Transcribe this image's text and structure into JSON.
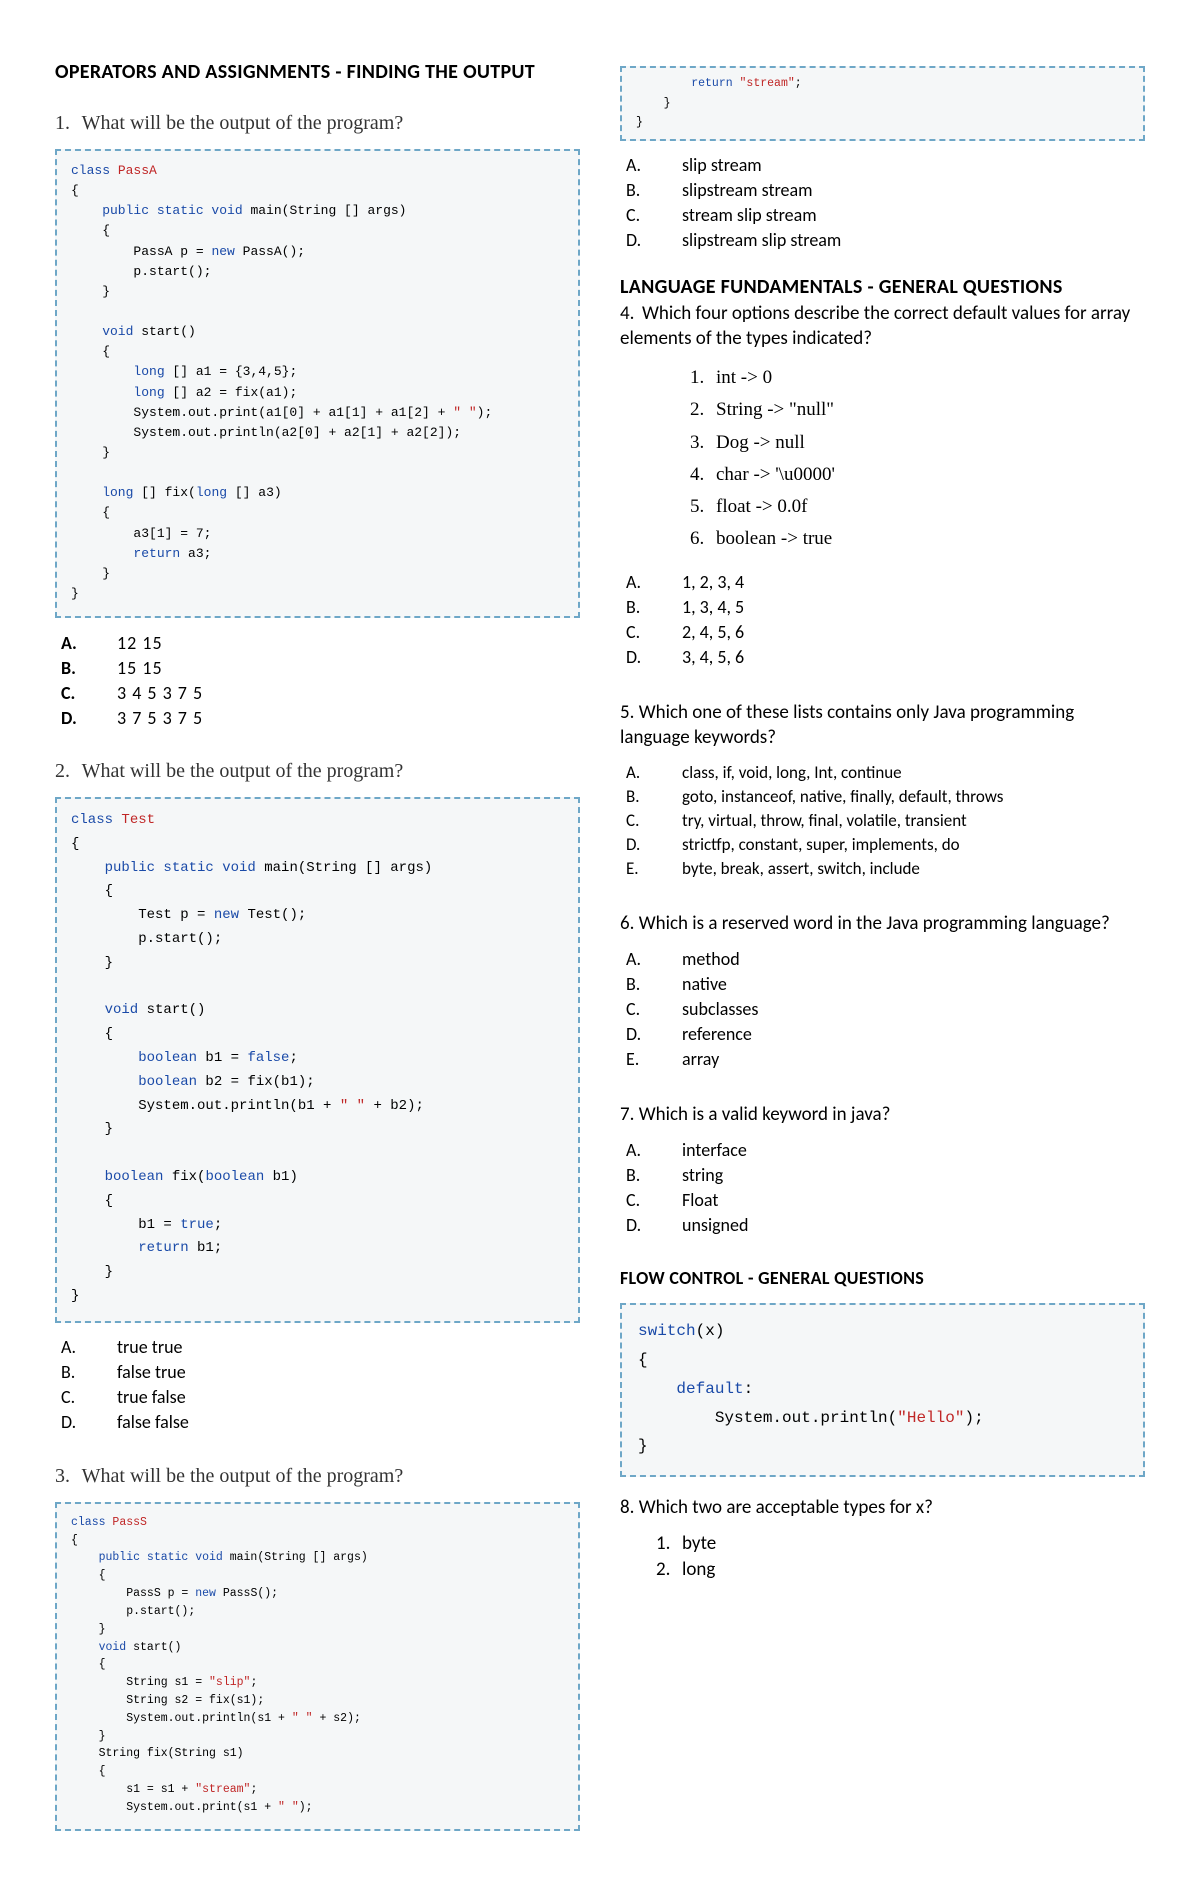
{
  "left": {
    "section1_title": "OPERATORS AND ASSIGNMENTS - FINDING THE OUTPUT",
    "q1": {
      "num": "1.",
      "text": "What will be the output of the program?",
      "code": {
        "l01a": "class ",
        "l01b": "PassA",
        "l02": "{",
        "l03a": "    public static void",
        "l03b": " main(String [] args)",
        "l04": "    {",
        "l05a": "        PassA p = ",
        "l05b": "new",
        "l05c": " PassA();",
        "l06": "        p.start();",
        "l07": "    }",
        "l08": "",
        "l09a": "    void",
        "l09b": " start()",
        "l10": "    {",
        "l11a": "        long",
        "l11b": " [] a1 = {3,4,5};",
        "l12a": "        long",
        "l12b": " [] a2 = fix(a1);",
        "l13a": "        System.out.print(a1[0] + a1[1] + a1[2] + ",
        "l13b": "\" \"",
        "l13c": ");",
        "l14": "        System.out.println(a2[0] + a2[1] + a2[2]);",
        "l15": "    }",
        "l16": "",
        "l17a": "    long",
        "l17b": " [] fix(",
        "l17c": "long",
        "l17d": " [] a3)",
        "l18": "    {",
        "l19": "        a3[1] = 7;",
        "l20a": "        return",
        "l20b": " a3;",
        "l21": "    }",
        "l22": "}"
      },
      "answers": [
        {
          "lbl": "A.",
          "val": "12 15"
        },
        {
          "lbl": "B.",
          "val": "15 15"
        },
        {
          "lbl": "C.",
          "val": "3 4 5 3 7 5"
        },
        {
          "lbl": "D.",
          "val": "3 7 5 3 7 5"
        }
      ]
    },
    "q2": {
      "num": "2.",
      "text": "What will be the output of the program?",
      "code": {
        "l01a": "class ",
        "l01b": "Test",
        "l02": "{",
        "l03a": "    public static void",
        "l03b": " main(String [] args)",
        "l04": "    {",
        "l05a": "        Test p = ",
        "l05b": "new",
        "l05c": " Test();",
        "l06": "        p.start();",
        "l07": "    }",
        "l08": "",
        "l09a": "    void",
        "l09b": " start()",
        "l10": "    {",
        "l11a": "        boolean",
        "l11b": " b1 = ",
        "l11c": "false",
        "l11d": ";",
        "l12a": "        boolean",
        "l12b": " b2 = fix(b1);",
        "l13a": "        System.out.println(b1 + ",
        "l13b": "\" \"",
        "l13c": " + b2);",
        "l14": "    }",
        "l15": "",
        "l16a": "    boolean",
        "l16b": " fix(",
        "l16c": "boolean",
        "l16d": " b1)",
        "l17": "    {",
        "l18a": "        b1 = ",
        "l18b": "true",
        "l18c": ";",
        "l19a": "        return",
        "l19b": " b1;",
        "l20": "    }",
        "l21": "}"
      },
      "answers": [
        {
          "lbl": "A.",
          "val": "true true"
        },
        {
          "lbl": "B.",
          "val": "false true"
        },
        {
          "lbl": "C.",
          "val": "true false"
        },
        {
          "lbl": "D.",
          "val": "false false"
        }
      ]
    },
    "q3": {
      "num": "3.",
      "text": "What will be the output of the program?",
      "code": {
        "l01a": "class ",
        "l01b": "PassS",
        "l02": "{",
        "l03a": "    public static void",
        "l03b": " main(String [] args)",
        "l04": "    {",
        "l05a": "        PassS p = ",
        "l05b": "new",
        "l05c": " PassS();",
        "l06": "        p.start();",
        "l07": "    }",
        "l08a": "    void",
        "l08b": " start()",
        "l09": "    {",
        "l10a": "        String s1 = ",
        "l10b": "\"slip\"",
        "l10c": ";",
        "l11": "        String s2 = fix(s1);",
        "l12a": "        System.out.println(s1 + ",
        "l12b": "\" \"",
        "l12c": " + s2);",
        "l13": "    }",
        "l14": "    String fix(String s1)",
        "l15": "    {",
        "l16a": "        s1 = s1 + ",
        "l16b": "\"stream\"",
        "l16c": ";",
        "l17a": "        System.out.print(s1 + ",
        "l17b": "\" \"",
        "l17c": ");"
      }
    }
  },
  "right": {
    "q3code_cont": {
      "l01a": "        return ",
      "l01b": "\"stream\"",
      "l01c": ";",
      "l02": "    }",
      "l03": "}"
    },
    "q3answers": [
      {
        "lbl": "A.",
        "val": "slip stream"
      },
      {
        "lbl": "B.",
        "val": "slipstream stream"
      },
      {
        "lbl": "C.",
        "val": "stream slip stream"
      },
      {
        "lbl": "D.",
        "val": "slipstream slip stream"
      }
    ],
    "section2_title": "LANGUAGE FUNDAMENTALS - GENERAL QUESTIONS",
    "q4": {
      "num": "4.",
      "text": "Which four options describe the correct default values for array elements of the types indicated?",
      "items": [
        {
          "n": "1.",
          "t": "int -> 0"
        },
        {
          "n": "2.",
          "t": "String -> \"null\""
        },
        {
          "n": "3.",
          "t": "Dog -> null"
        },
        {
          "n": "4.",
          "t": "char -> '\\u0000'"
        },
        {
          "n": "5.",
          "t": "float -> 0.0f"
        },
        {
          "n": "6.",
          "t": "boolean -> true"
        }
      ],
      "answers": [
        {
          "lbl": "A.",
          "val": "1, 2, 3, 4"
        },
        {
          "lbl": "B.",
          "val": "1, 3, 4, 5"
        },
        {
          "lbl": "C.",
          "val": "2, 4, 5, 6"
        },
        {
          "lbl": "D.",
          "val": "3, 4, 5, 6"
        }
      ]
    },
    "q5": {
      "intro": "5. Which one of these lists contains only Java programming language keywords?",
      "answers": [
        {
          "lbl": "A.",
          "val": "class, if, void, long, Int, continue"
        },
        {
          "lbl": "B.",
          "val": "goto, instanceof, native, finally, default, throws"
        },
        {
          "lbl": "C.",
          "val": "try, virtual, throw, final, volatile, transient"
        },
        {
          "lbl": "D.",
          "val": "strictfp, constant, super, implements, do"
        },
        {
          "lbl": "E.",
          "val": "byte, break, assert, switch, include"
        }
      ]
    },
    "q6": {
      "intro": "6. Which is a reserved word in the Java programming language?",
      "answers": [
        {
          "lbl": "A.",
          "val": "method"
        },
        {
          "lbl": "B.",
          "val": "native"
        },
        {
          "lbl": "C.",
          "val": "subclasses"
        },
        {
          "lbl": "D.",
          "val": "reference"
        },
        {
          "lbl": "E.",
          "val": "array"
        }
      ]
    },
    "q7": {
      "intro": "7. Which is a valid keyword in java?",
      "answers": [
        {
          "lbl": "A.",
          "val": "interface"
        },
        {
          "lbl": "B.",
          "val": "string"
        },
        {
          "lbl": "C.",
          "val": "Float"
        },
        {
          "lbl": "D.",
          "val": "unsigned"
        }
      ]
    },
    "section3_title": "FLOW CONTROL - GENERAL QUESTIONS",
    "flowcode": {
      "l1a": "switch",
      "l1b": "(x)",
      "l2": "{",
      "l3a": "    default",
      "l3b": ":",
      "l4a": "        System.out.println(",
      "l4b": "\"Hello\"",
      "l4c": ");",
      "l5": "}"
    },
    "q8": {
      "intro": "8. Which two are acceptable types for x?",
      "items": [
        {
          "n": "1.",
          "t": "byte"
        },
        {
          "n": "2.",
          "t": "long"
        }
      ]
    }
  }
}
